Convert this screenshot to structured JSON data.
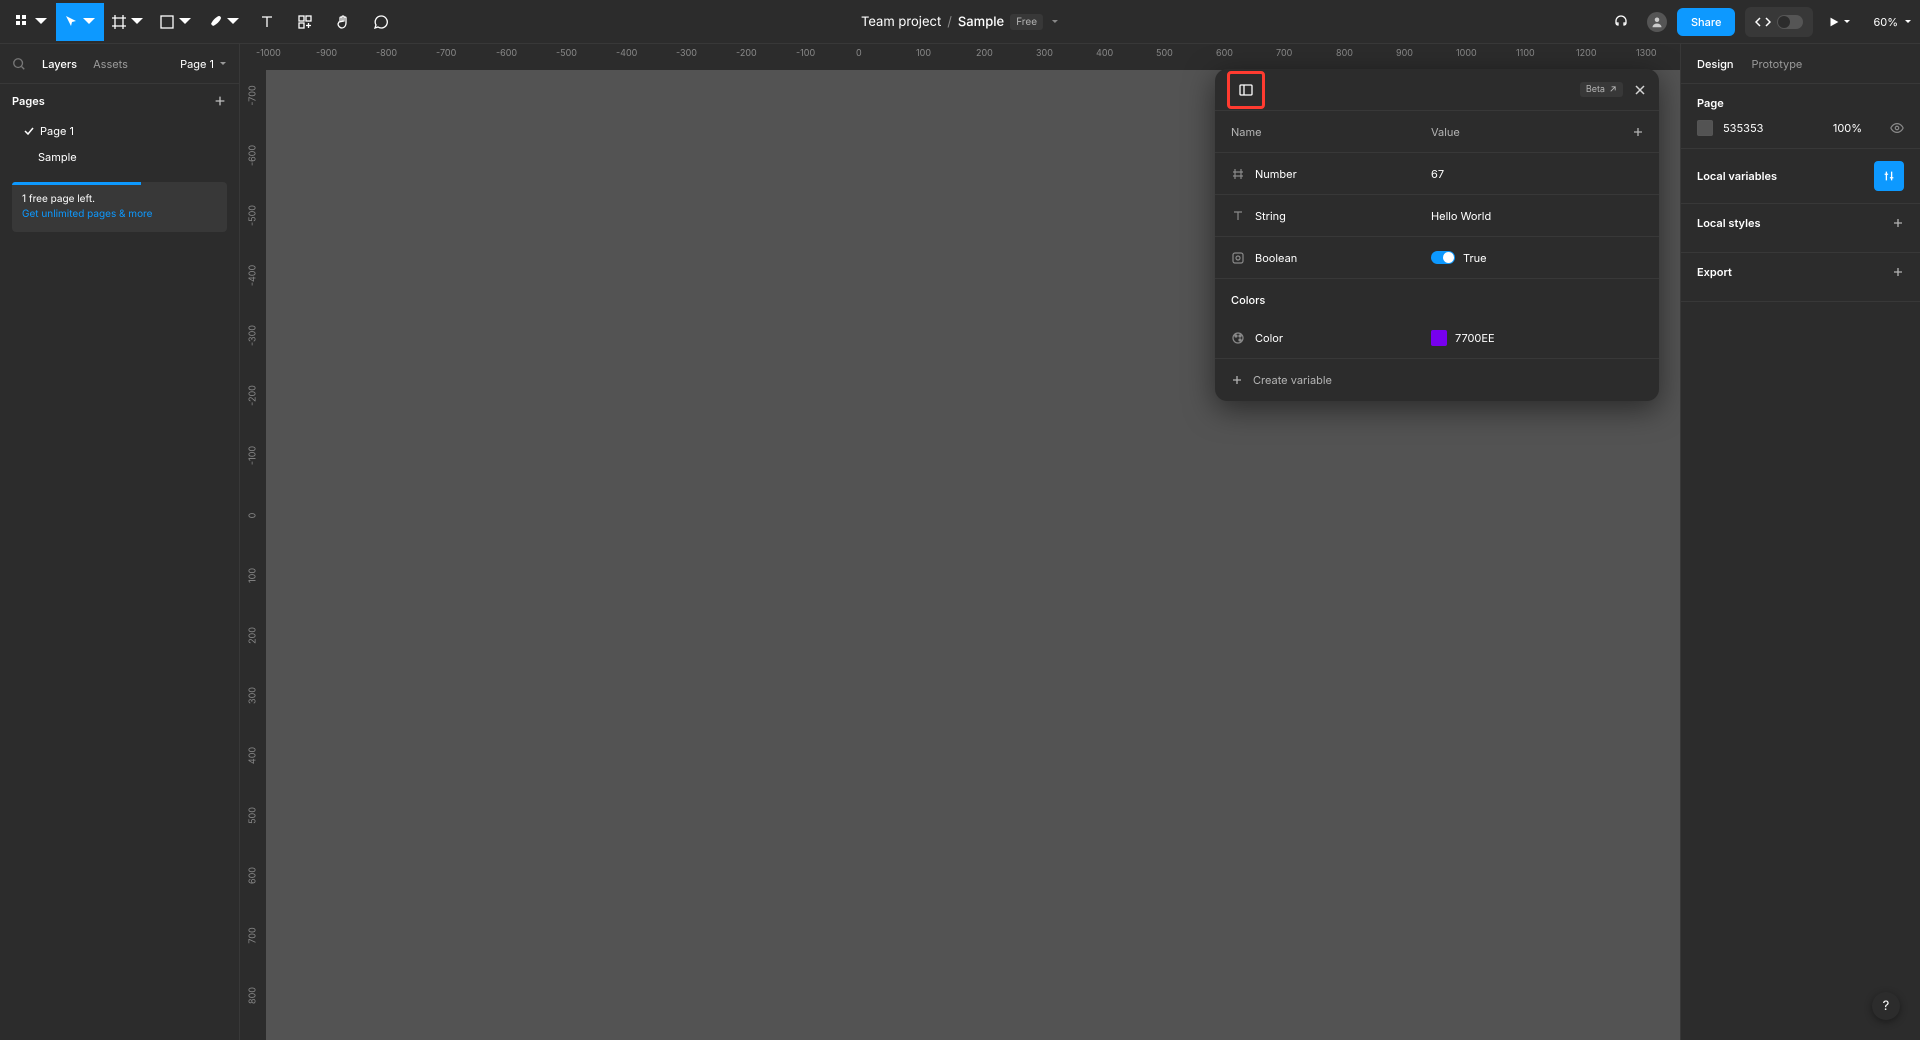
{
  "topbar": {
    "breadcrumb_team": "Team project",
    "breadcrumb_file": "Sample",
    "free_badge": "Free",
    "share": "Share",
    "zoom": "60%"
  },
  "left": {
    "tab_layers": "Layers",
    "tab_assets": "Assets",
    "page_selector": "Page 1",
    "pages_label": "Pages",
    "pages": [
      "Page 1"
    ],
    "layers": [
      "Sample"
    ],
    "promo_line1": "1 free page left.",
    "promo_link": "Get unlimited pages & more"
  },
  "ruler_h": [
    "-1000",
    "-900",
    "-800",
    "-700",
    "-600",
    "-500",
    "-400",
    "-300",
    "-200",
    "-100",
    "0",
    "100",
    "200",
    "300",
    "400",
    "500",
    "600",
    "700",
    "800",
    "900",
    "1000",
    "1100",
    "1200",
    "1300"
  ],
  "ruler_v": [
    "-700",
    "-600",
    "-500",
    "-400",
    "-300",
    "-200",
    "-100",
    "0",
    "100",
    "200",
    "300",
    "400",
    "500",
    "600",
    "700",
    "800"
  ],
  "variables_panel": {
    "beta": "Beta",
    "col_name": "Name",
    "col_value": "Value",
    "rows": [
      {
        "type": "number",
        "name": "Number",
        "value": "67"
      },
      {
        "type": "string",
        "name": "String",
        "value": "Hello World"
      },
      {
        "type": "boolean",
        "name": "Boolean",
        "value": "True"
      }
    ],
    "colors_label": "Colors",
    "color_rows": [
      {
        "name": "Color",
        "value": "7700EE"
      }
    ],
    "create": "Create variable"
  },
  "right": {
    "tab_design": "Design",
    "tab_prototype": "Prototype",
    "page_label": "Page",
    "bg_hex": "535353",
    "bg_pct": "100%",
    "local_variables": "Local variables",
    "local_styles": "Local styles",
    "export": "Export"
  },
  "help": "?"
}
